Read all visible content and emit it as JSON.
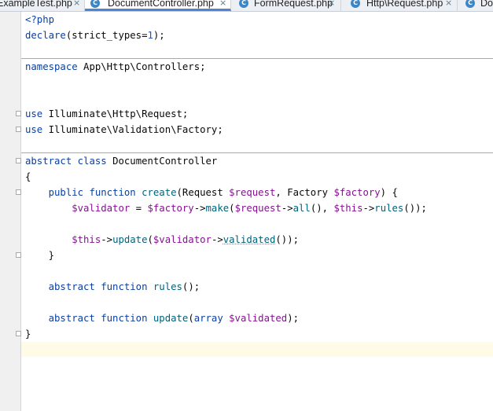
{
  "tabs": [
    {
      "label": "ExampleTest.php",
      "active": false,
      "icon": "php-file-icon"
    },
    {
      "label": "DocumentController.php",
      "active": true,
      "icon": "php-class-icon"
    },
    {
      "label": "FormRequest.php",
      "active": false,
      "icon": "php-class-icon"
    },
    {
      "label": "Http\\Request.php",
      "active": false,
      "icon": "php-class-icon"
    },
    {
      "label": "Do",
      "active": false,
      "icon": "php-class-icon"
    }
  ],
  "close_glyph": "×",
  "tab_icon_letter": "C",
  "code": {
    "l1": {
      "a": "<?php"
    },
    "l2": {
      "a": "declare",
      "b": "(strict_types=",
      "c": "1",
      "d": ");"
    },
    "l3": {
      "a": "namespace",
      "b": " App\\Http\\Controllers;"
    },
    "l4": {
      "a": "use",
      "b": " Illuminate\\Http\\Request;"
    },
    "l5": {
      "a": "use",
      "b": " Illuminate\\Validation\\Factory;"
    },
    "l6": {
      "a": "abstract",
      "b": " ",
      "c": "class",
      "d": " DocumentController"
    },
    "l7": {
      "a": "{"
    },
    "l8": {
      "a": "    public",
      "b": " ",
      "c": "function",
      "d": " ",
      "e": "create",
      "f": "(Request ",
      "g": "$request",
      "h": ", Factory ",
      "i": "$factory",
      "j": ") {"
    },
    "l9": {
      "a": "        $validator",
      "b": " = ",
      "c": "$factory",
      "d": "->",
      "e": "make",
      "f": "(",
      "g": "$request",
      "h": "->",
      "i": "all",
      "j": "(), ",
      "k": "$this",
      "l": "->",
      "m": "rules",
      "n": "());"
    },
    "l10": {
      "a": "        $this",
      "b": "->",
      "c": "update",
      "d": "(",
      "e": "$validator",
      "f": "->",
      "g": "validated",
      "h": "());"
    },
    "l11": {
      "a": "    }"
    },
    "l12": {
      "a": "    abstract",
      "b": " ",
      "c": "function",
      "d": " ",
      "e": "rules",
      "f": "();"
    },
    "l13": {
      "a": "    abstract",
      "b": " ",
      "c": "function",
      "d": " ",
      "e": "update",
      "f": "(",
      "g": "array",
      "h": " ",
      "i": "$validated",
      "j": ");"
    },
    "l14": {
      "a": "}"
    }
  }
}
